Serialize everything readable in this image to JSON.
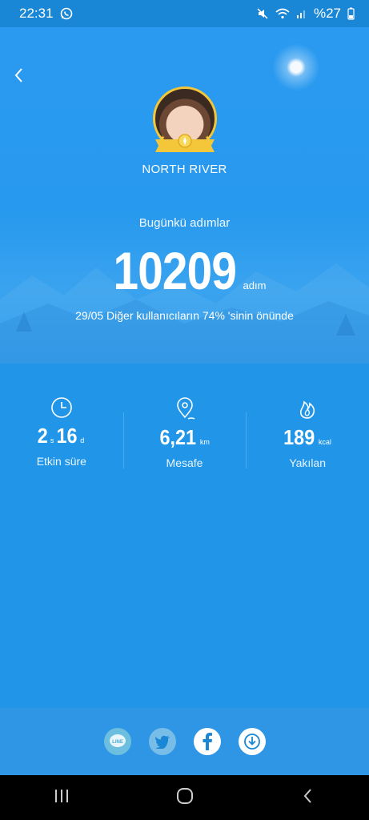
{
  "status_bar": {
    "time": "22:31",
    "battery": "%27"
  },
  "profile": {
    "name": "NORTH RIVER"
  },
  "today": {
    "label": "Bugünkü adımlar",
    "steps": "10209",
    "steps_unit": "adım",
    "rank_text": "29/05 Diğer kullanıcıların 74% 'sinin önünde"
  },
  "stats": {
    "active": {
      "hours": "2",
      "hours_unit": "s",
      "minutes": "16",
      "minutes_unit": "d",
      "label": "Etkin süre",
      "icon": "clock-icon"
    },
    "distance": {
      "value": "6,21",
      "unit": "km",
      "label": "Mesafe",
      "icon": "location-pin-icon"
    },
    "calories": {
      "value": "189",
      "unit": "kcal",
      "label": "Yakılan",
      "icon": "flame-icon"
    }
  },
  "share": {
    "line_label": "LINE",
    "items": [
      "line-icon",
      "twitter-icon",
      "facebook-icon",
      "download-icon"
    ]
  },
  "colors": {
    "background": "#2196e9",
    "gold": "#f4c63a"
  }
}
